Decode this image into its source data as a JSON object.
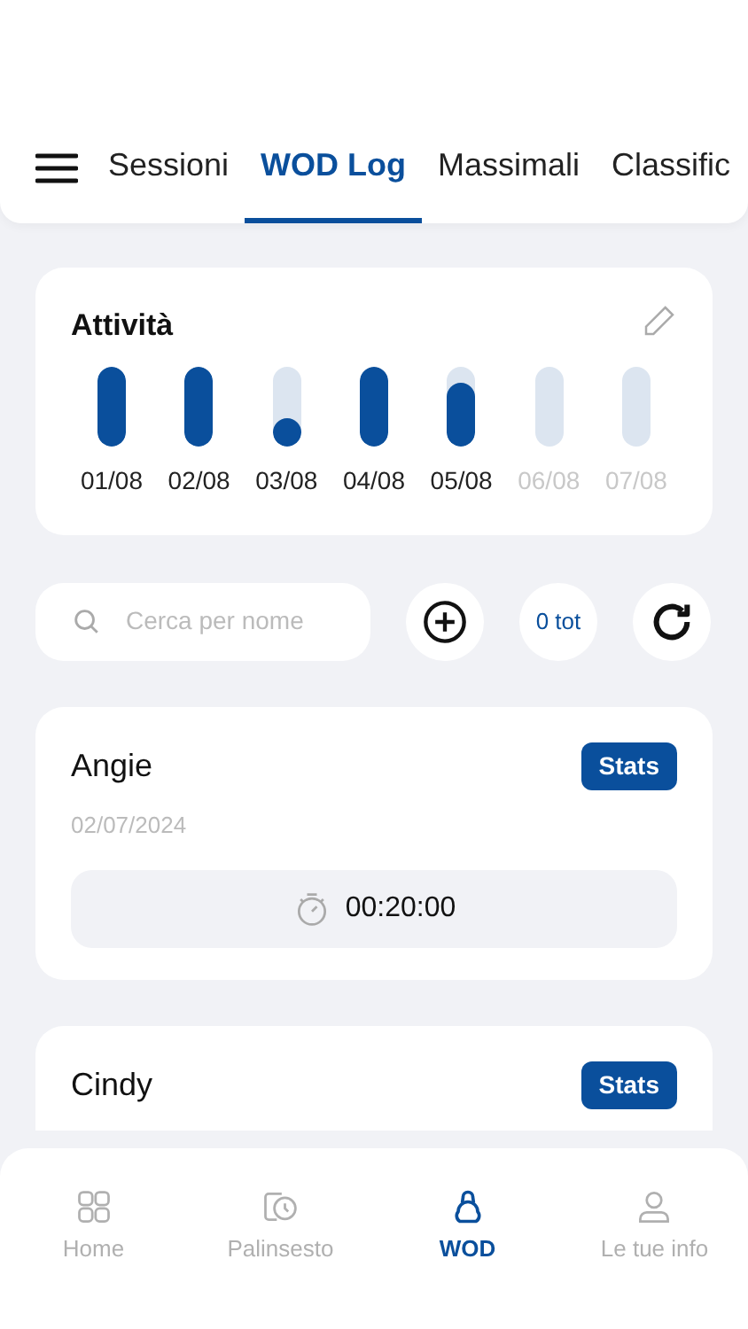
{
  "tabs": [
    {
      "label": "Sessioni",
      "selected": false
    },
    {
      "label": "WOD Log",
      "selected": true
    },
    {
      "label": "Massimali",
      "selected": false
    },
    {
      "label": "Classific",
      "selected": false
    }
  ],
  "activity": {
    "title": "Attività",
    "days": [
      {
        "label": "01/08",
        "level": 1,
        "future": false
      },
      {
        "label": "02/08",
        "level": 1,
        "future": false
      },
      {
        "label": "03/08",
        "level": 0.35,
        "future": false
      },
      {
        "label": "04/08",
        "level": 1,
        "future": false
      },
      {
        "label": "05/08",
        "level": 0.8,
        "future": false
      },
      {
        "label": "06/08",
        "future": true
      },
      {
        "label": "07/08",
        "future": true
      }
    ]
  },
  "search": {
    "placeholder": "Cerca per nome"
  },
  "total": "0 tot",
  "workouts": [
    {
      "name": "Angie",
      "badge": "Stats",
      "date": "02/07/2024",
      "time": "00:20:00"
    },
    {
      "name": "Cindy",
      "badge": "Stats"
    }
  ],
  "nav": [
    {
      "label": "Home",
      "selected": false,
      "kind": "grid"
    },
    {
      "label": "Palinsesto",
      "selected": false,
      "kind": "history"
    },
    {
      "label": "WOD",
      "selected": true,
      "kind": "kettlebell"
    },
    {
      "label": "Le tue info",
      "selected": false,
      "kind": "user"
    }
  ]
}
